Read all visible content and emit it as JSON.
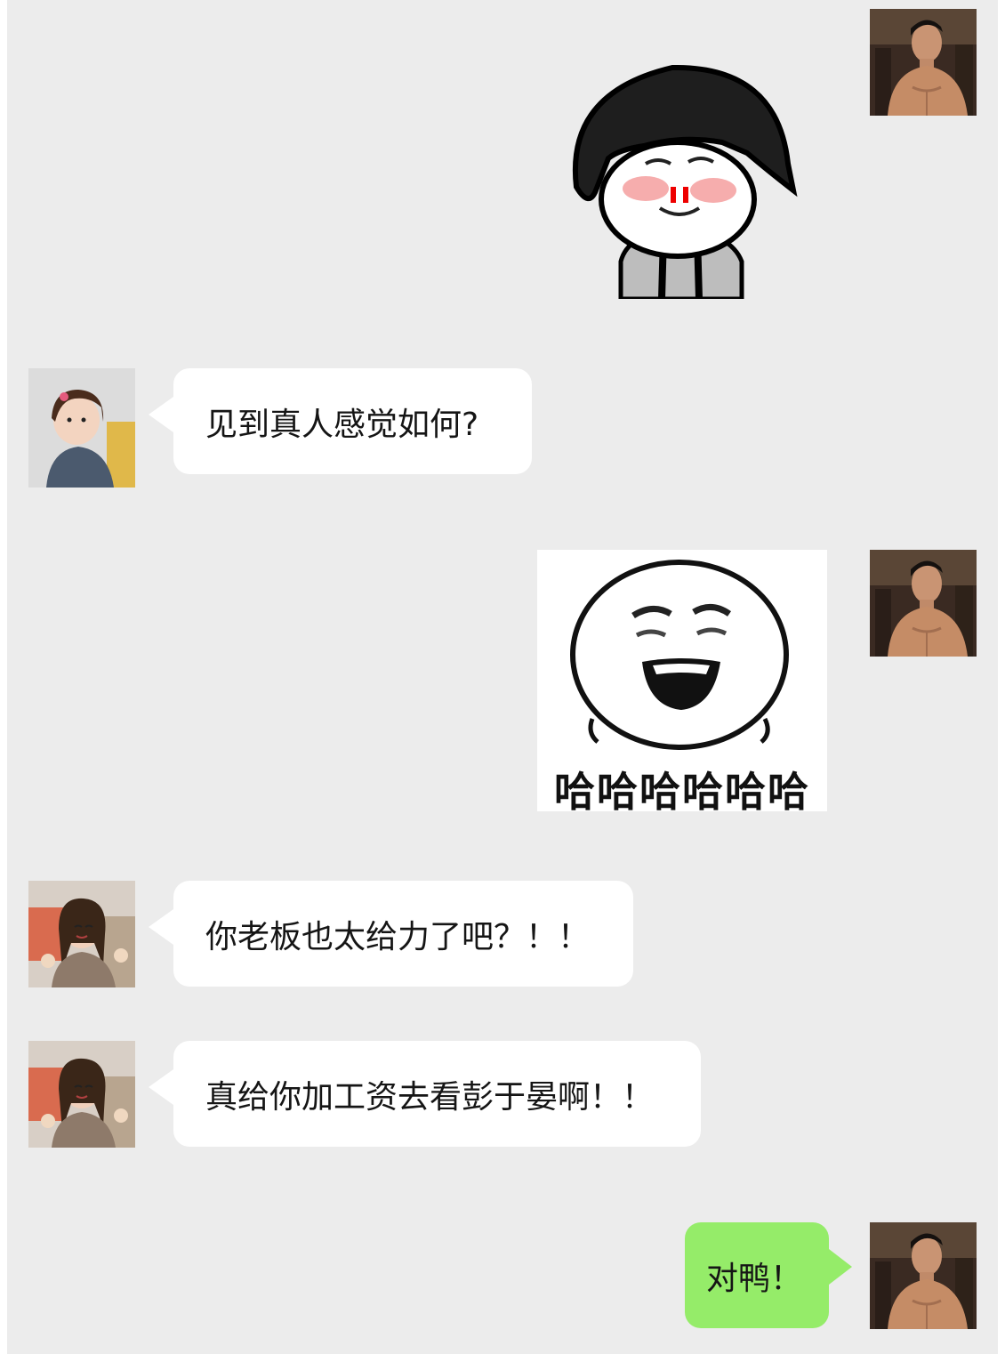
{
  "messages": [
    {
      "side": "right",
      "type": "sticker",
      "sticker": "mushroom-head-nosebleed-icon"
    },
    {
      "side": "left",
      "type": "text",
      "text": "见到真人感觉如何?"
    },
    {
      "side": "right",
      "type": "sticker",
      "sticker": "laughing-face-icon",
      "caption": "哈哈哈哈哈哈"
    },
    {
      "side": "left",
      "type": "text",
      "text": "你老板也太给力了吧？！！"
    },
    {
      "side": "left",
      "type": "text",
      "text": "真给你加工资去看彭于晏啊！！"
    },
    {
      "side": "right",
      "type": "text",
      "text": "对鸭！"
    }
  ],
  "colors": {
    "background": "#ececec",
    "bubble_left": "#ffffff",
    "bubble_right": "#95ec69",
    "text": "#151515"
  }
}
